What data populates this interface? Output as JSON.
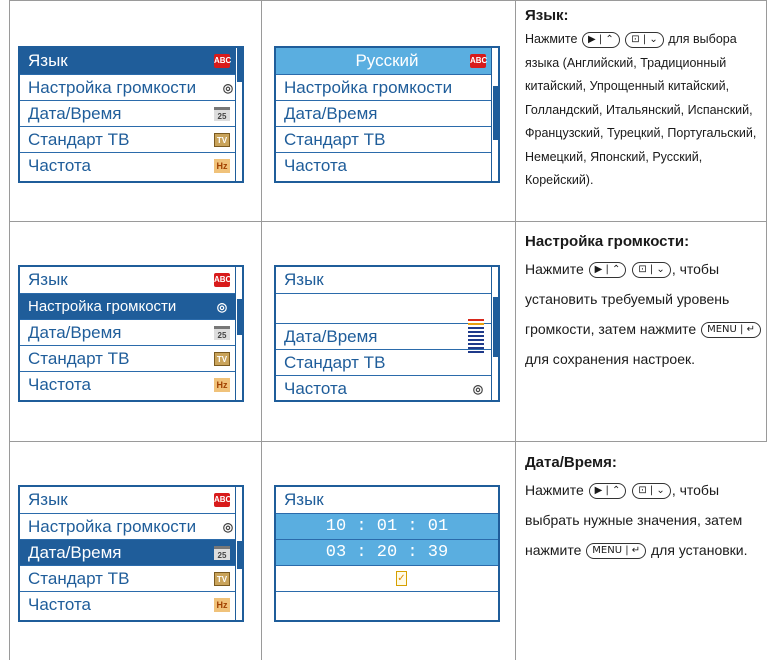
{
  "menu_items": [
    "Язык",
    "Настройка громкости",
    "Дата/Время",
    "Стандарт ТВ",
    "Частота"
  ],
  "icons": [
    "abc-icon",
    "speaker-icon",
    "calendar-icon",
    "tv-icon",
    "hz-icon"
  ],
  "icon_labels": {
    "abc": "ABC",
    "tv": "TV",
    "hz": "Hz",
    "cal": "25"
  },
  "keys": {
    "play_up": "▶ | ⌃",
    "menu_down": "⊡ | ⌄",
    "menu_enter": "MENU | ↵"
  },
  "section1": {
    "submenu": [
      "Русский",
      "Настройка громкости",
      "Дата/Время",
      "Стандарт ТВ",
      "Частота"
    ],
    "title": "Язык:",
    "text_before": "Нажмите",
    "text_after": "для выбора языка (Английский, Традиционный китайский, Упрощенный китайский, Голландский, Итальянский, Испанский, Французский, Турецкий, Португальский, Немецкий, Японский, Русский, Корейский)."
  },
  "section2": {
    "submenu": [
      "Язык",
      "",
      "Дата/Время",
      "Стандарт ТВ",
      "Частота"
    ],
    "volume_level": 0.9,
    "title": "Настройка громкости:",
    "text_before": "Нажмите",
    "text_mid": ", чтобы установить требуемый уровень громкости, затем нажмите",
    "text_after": "для сохранения настроек."
  },
  "section3": {
    "submenu": [
      "Язык",
      "10 : 01 : 01",
      "03 : 20 : 39",
      "",
      ""
    ],
    "title": "Дата/Время:",
    "text_before": "Нажмите",
    "text_mid": ", чтобы выбрать нужные значения, затем нажмите",
    "text_after": "для установки."
  }
}
